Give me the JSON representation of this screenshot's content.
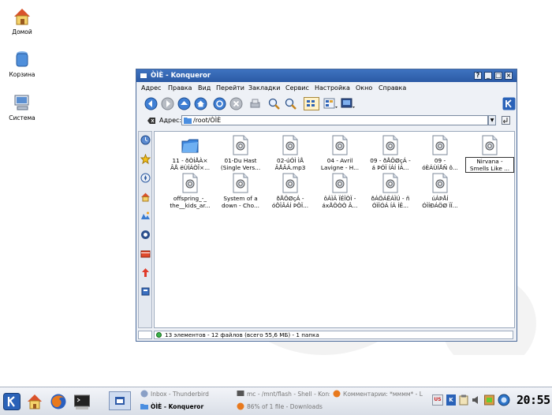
{
  "desktop": {
    "icons": [
      {
        "label": "Домой",
        "icon": "home-icon"
      },
      {
        "label": "Корзина",
        "icon": "trash-icon"
      },
      {
        "label": "Система",
        "icon": "computer-icon"
      }
    ]
  },
  "window": {
    "title": "ÒÌÈ - Konqueror",
    "buttons": [
      "?",
      "_",
      "□",
      "×"
    ],
    "menu": [
      "Адрес",
      "Правка",
      "Вид",
      "Перейти",
      "Закладки",
      "Сервис",
      "Настройка",
      "Окно",
      "Справка"
    ],
    "toolbar_icons": [
      "back-icon",
      "forward-icon",
      "up-icon",
      "home-icon",
      "reload-icon",
      "stop-icon",
      "print-icon",
      "zoom-in-icon",
      "zoom-out-icon",
      "icon-view-icon",
      "detail-view-icon",
      "preview-icon",
      "kde-logo-icon"
    ],
    "location": {
      "label": "Адрес:",
      "value": "/root/ÒÌÈ"
    },
    "sidebar_icons": [
      "history-icon",
      "bookmarks-icon",
      "network-icon",
      "home-icon",
      "media-icon",
      "services-icon",
      "root-folder-icon",
      "tips-icon",
      "notes-icon"
    ],
    "files": [
      {
        "name": "11 - ðÒÍÅÀ×\nÂÅ ëÙÍÁÒÎ×...",
        "type": "folder"
      },
      {
        "name": "01-Du Hast\n(Single Vers...",
        "type": "audio"
      },
      {
        "name": "02-úÓÌ ÌÅ\nÂÅÂÁ.mp3",
        "type": "audio"
      },
      {
        "name": "04 - Avril\nLavigne - H...",
        "type": "audio"
      },
      {
        "name": "09 - ðÅÖØçÁ -\ná ÞÓÏ ÍÁÍ ÍÁ...",
        "type": "audio"
      },
      {
        "name": "09 -\nóÈÁÙÍÅÑ ô...",
        "type": "audio"
      },
      {
        "name": "Nirvana -\nSmells Like ...",
        "type": "audio",
        "selected": true
      },
      {
        "name": "offspring_-_\nthe__kids_ar...",
        "type": "audio"
      },
      {
        "name": "System of a\ndown - Cho...",
        "type": "audio"
      },
      {
        "name": "ðÅÖØçÁ -\nóÔÏÂÁÍ ÞÔÏ...",
        "type": "audio"
      },
      {
        "name": "ôÁÌÄ ÏÉÏÒÏ -\náxÅÖÒÒ Â...",
        "type": "audio"
      },
      {
        "name": "ðÁÖÁËÁÏÚ - ñ\nÓÏÍÓÁ ÍÁ ÍË...",
        "type": "audio"
      },
      {
        "name": "úÁÞÅÍ\nÓÏÍÐÁÖØ ÏÏ...",
        "type": "audio"
      }
    ],
    "status": "13 элементов - 12 файлов (всего 55,6 МБ) - 1 папка"
  },
  "taskbar": {
    "launchers": [
      "kde-menu-icon",
      "home-icon",
      "firefox-icon",
      "terminal-icon"
    ],
    "tasks_row1": [
      "Inbox - Thunderbird",
      "mc - /mnt/flash - Shell - Konso",
      "Комментарии: *мммм* - L"
    ],
    "tasks_row2": [
      "ÒÌÈ - Konqueror",
      "86% of 1 file - Downloads"
    ],
    "tray": [
      "US",
      "K"
    ],
    "clock": "20:55"
  },
  "colors": {
    "title_bar": "#2f62ad",
    "accent": "#3e73c0"
  }
}
